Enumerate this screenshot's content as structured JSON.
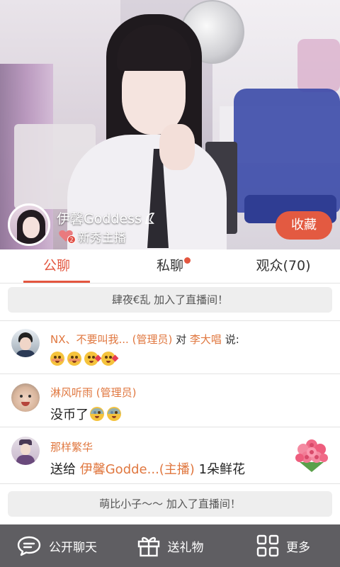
{
  "anchor": {
    "name": "伊馨Goddess",
    "level_badge": "2",
    "level_label": "新秀主播",
    "favorite_label": "收藏"
  },
  "tabs": [
    {
      "label": "公聊",
      "active": true
    },
    {
      "label": "私聊",
      "has_dot": true
    },
    {
      "label": "观众(70)"
    }
  ],
  "chat": {
    "system_messages": [
      "肆夜€乱 加入了直播间！",
      "萌比小子～～ 加入了直播间！"
    ],
    "messages": [
      {
        "user": "NX、不要叫我...",
        "role": "(管理员)",
        "to_word": "对",
        "target": "李大唱",
        "said": "说:",
        "emojis": [
          "flushed-emoji",
          "flushed-emoji",
          "kiss-emoji",
          "kiss-emoji"
        ]
      },
      {
        "user": "淋风听雨",
        "role": "(管理员)",
        "text": "没币了",
        "emojis": [
          "sweat-emoji",
          "sweat-emoji"
        ]
      },
      {
        "user": "那样繁华",
        "gift_prefix": "送给",
        "gift_target": "伊馨Godde...(主播)",
        "gift_item": "1朵鲜花",
        "gift_icon": "rose-bouquet-icon"
      }
    ]
  },
  "bottom_bar": [
    {
      "label": "公开聊天",
      "icon": "chat-bubble-icon"
    },
    {
      "label": "送礼物",
      "icon": "gift-icon"
    },
    {
      "label": "更多",
      "icon": "grid-icon"
    }
  ],
  "colors": {
    "accent": "#e3563f",
    "username": "#e0773f",
    "bottom_bar_bg": "#5f5e62"
  }
}
